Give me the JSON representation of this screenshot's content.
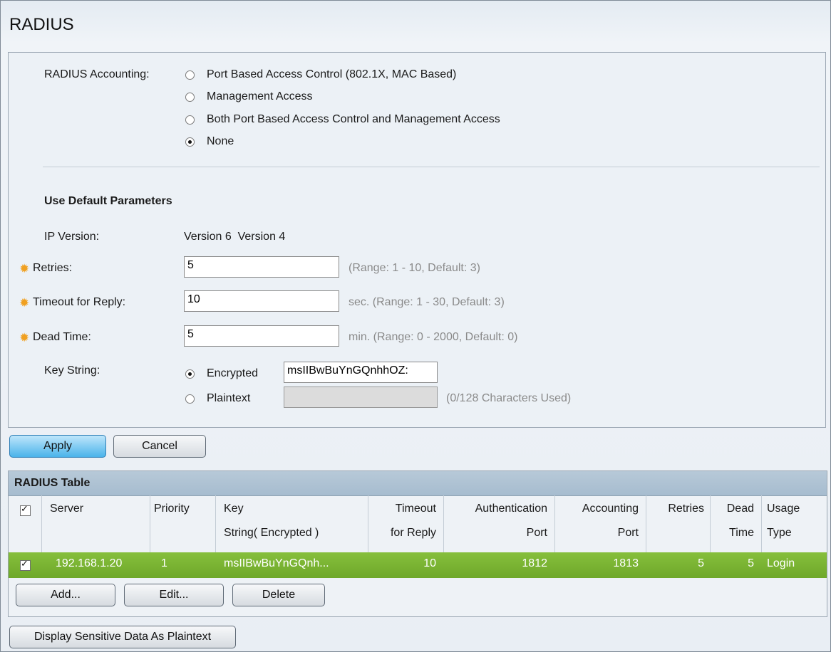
{
  "page_title": "RADIUS",
  "accounting": {
    "label": "RADIUS Accounting:",
    "options": [
      {
        "label": "Port Based Access Control (802.1X, MAC Based)",
        "selected": false
      },
      {
        "label": "Management Access",
        "selected": false
      },
      {
        "label": "Both Port Based Access Control and Management Access",
        "selected": false
      },
      {
        "label": "None",
        "selected": true
      }
    ]
  },
  "defaults": {
    "heading": "Use Default Parameters",
    "ip_version_label": "IP Version:",
    "ip_version_value": "Version 6  Version 4",
    "retries_label": "Retries:",
    "retries_value": "5",
    "retries_hint": "(Range: 1 - 10, Default: 3)",
    "timeout_label": "Timeout for Reply:",
    "timeout_value": "10",
    "timeout_hint": "sec. (Range: 1 - 30, Default: 3)",
    "dead_label": "Dead Time:",
    "dead_value": "5",
    "dead_hint": "min. (Range: 0 - 2000, Default: 0)",
    "key_label": "Key String:",
    "encrypted_label": "Encrypted",
    "encrypted_value": "msIIBwBuYnGQnhhOZ:",
    "plaintext_label": "Plaintext",
    "plaintext_value": "",
    "plaintext_hint": "(0/128 Characters Used)",
    "key_mode": "encrypted"
  },
  "buttons": {
    "apply": "Apply",
    "cancel": "Cancel",
    "add": "Add...",
    "edit": "Edit...",
    "delete": "Delete",
    "display_sensitive": "Display Sensitive Data As Plaintext"
  },
  "table": {
    "title": "RADIUS Table",
    "headers": {
      "server": "Server",
      "priority": "Priority",
      "key_1": "Key",
      "key_2": "String( Encrypted )",
      "timeout_1": "Timeout",
      "timeout_2": "for Reply",
      "auth_1": "Authentication",
      "auth_2": "Port",
      "acct_1": "Accounting",
      "acct_2": "Port",
      "retries": "Retries",
      "dead_1": "Dead",
      "dead_2": "Time",
      "usage_1": "Usage",
      "usage_2": "Type"
    },
    "rows": [
      {
        "checked": true,
        "server": "192.168.1.20",
        "priority": "1",
        "key": "msIIBwBuYnGQnh...",
        "timeout": "10",
        "auth_port": "1812",
        "acct_port": "1813",
        "retries": "5",
        "dead_time": "5",
        "usage": "Login"
      }
    ]
  },
  "colors": {
    "selected_row": "#78b432",
    "primary_button": "#4ab3ea",
    "required_star": "#f0a020"
  }
}
